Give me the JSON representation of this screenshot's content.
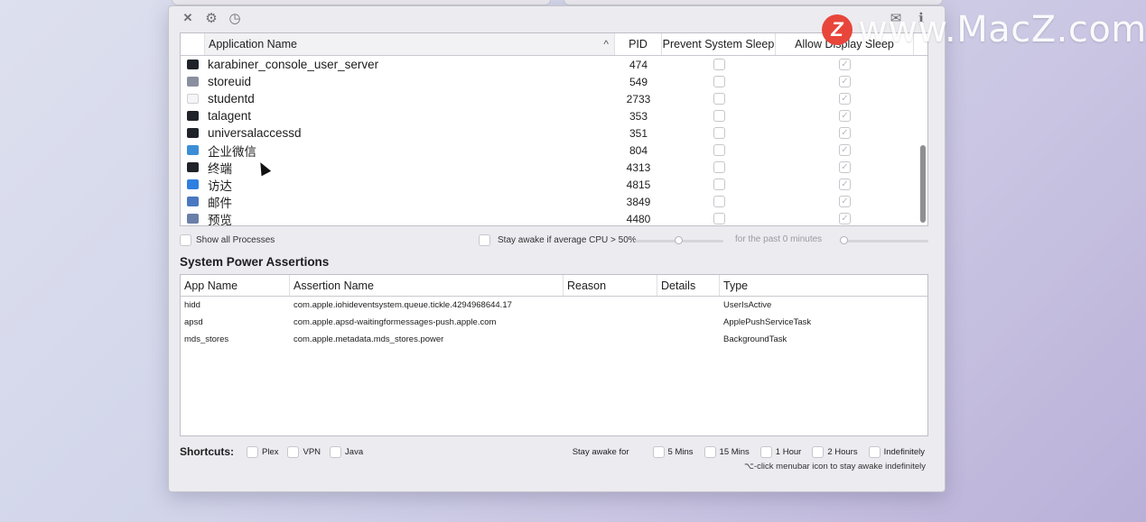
{
  "toolbar": {
    "icons": [
      "close-icon",
      "gear-icon",
      "clock-icon",
      "mail-icon",
      "info-icon"
    ],
    "close_glyph": "✕",
    "gear_glyph": "⚙",
    "clock_glyph": "◷",
    "mail_glyph": "✉",
    "info_glyph": "ℹ"
  },
  "apps_table": {
    "columns": {
      "name": "Application Name",
      "pid": "PID",
      "prevent": "Prevent System Sleep",
      "allow": "Allow Display Sleep"
    },
    "sort_glyph": "^",
    "rows": [
      {
        "name": "karabiner_console_user_server",
        "pid": "474",
        "icon": "terminal-icon",
        "icon_color": "#1f2329",
        "prevent": false,
        "allow": true
      },
      {
        "name": "storeuid",
        "pid": "549",
        "icon": "storeuid-icon",
        "icon_color": "#8a8fa0",
        "prevent": false,
        "allow": true
      },
      {
        "name": "studentd",
        "pid": "2733",
        "icon": "document-icon",
        "icon_color": "#f5f5f7",
        "prevent": false,
        "allow": true
      },
      {
        "name": "talagent",
        "pid": "353",
        "icon": "terminal-icon",
        "icon_color": "#1f2329",
        "prevent": false,
        "allow": true
      },
      {
        "name": "universalaccessd",
        "pid": "351",
        "icon": "terminal-icon",
        "icon_color": "#1f2329",
        "prevent": false,
        "allow": true
      },
      {
        "name": "企业微信",
        "pid": "804",
        "icon": "wecom-icon",
        "icon_color": "#3b8ed6",
        "prevent": false,
        "allow": true
      },
      {
        "name": "终端",
        "pid": "4313",
        "icon": "terminal-icon",
        "icon_color": "#1f2329",
        "prevent": false,
        "allow": true
      },
      {
        "name": "访达",
        "pid": "4815",
        "icon": "finder-icon",
        "icon_color": "#2f7fe0",
        "prevent": false,
        "allow": true
      },
      {
        "name": "邮件",
        "pid": "3849",
        "icon": "mail-app-icon",
        "icon_color": "#4a78c0",
        "prevent": false,
        "allow": true
      },
      {
        "name": "预览",
        "pid": "4480",
        "icon": "preview-icon",
        "icon_color": "#6a7fa8",
        "prevent": false,
        "allow": true
      }
    ]
  },
  "controls": {
    "show_all": "Show all Processes",
    "stay_awake_cpu": "Stay awake if average CPU > 50%",
    "cpu_slider_value": 0.49,
    "past_minutes": "for the past 0 minutes",
    "minutes_slider_value": 0
  },
  "assertions": {
    "title": "System Power Assertions",
    "columns": {
      "app": "App Name",
      "assertion": "Assertion Name",
      "reason": "Reason",
      "details": "Details",
      "type": "Type"
    },
    "rows": [
      {
        "app": "hidd",
        "assertion": "com.apple.iohideventsystem.queue.tickle.4294968644.17",
        "reason": "",
        "details": "",
        "type": "UserIsActive"
      },
      {
        "app": "apsd",
        "assertion": "com.apple.apsd-waitingformessages-push.apple.com",
        "reason": "",
        "details": "",
        "type": "ApplePushServiceTask"
      },
      {
        "app": "mds_stores",
        "assertion": "com.apple.metadata.mds_stores.power",
        "reason": "",
        "details": "",
        "type": "BackgroundTask"
      }
    ]
  },
  "shortcuts": {
    "label": "Shortcuts:",
    "items": [
      "Plex",
      "VPN",
      "Java"
    ]
  },
  "stay_awake": {
    "label": "Stay awake for",
    "options": [
      "5 Mins",
      "15 Mins",
      "1 Hour",
      "2 Hours",
      "Indefinitely"
    ],
    "hint": "⌥-click menubar icon to stay awake indefinitely"
  },
  "watermark": {
    "logo": "Z",
    "text": "www.MacZ.com"
  }
}
